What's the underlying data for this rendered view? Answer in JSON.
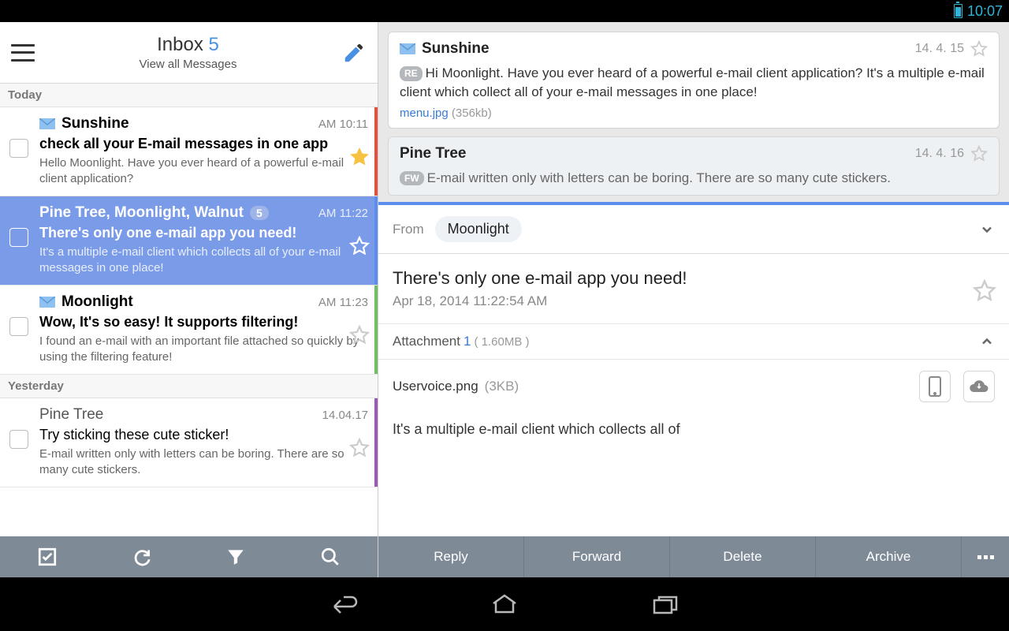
{
  "statusbar": {
    "time": "10:07"
  },
  "header": {
    "title": "Inbox",
    "count": "5",
    "subtitle": "View all Messages"
  },
  "sections": {
    "today": "Today",
    "yesterday": "Yesterday"
  },
  "messages": {
    "m0": {
      "sender": "Sunshine",
      "time": "AM 10:11",
      "subject": "check all your E-mail messages in one app",
      "preview": "Hello Moonlight. Have you ever heard of a powerful e-mail client application?"
    },
    "m1": {
      "sender": "Pine Tree, Moonlight, Walnut",
      "badge": "5",
      "time": "AM 11:22",
      "subject": "There's only one e-mail app you need!",
      "preview": "It's a multiple e-mail client which collects all of your e-mail messages in one place!"
    },
    "m2": {
      "sender": "Moonlight",
      "time": "AM 11:23",
      "subject": "Wow, It's so easy! It supports filtering!",
      "preview": "I found an e-mail with an important file attached so quickly by using the filtering feature!"
    },
    "m3": {
      "sender": "Pine Tree",
      "time": "14.04.17",
      "subject": "Try sticking these cute sticker!",
      "preview": "E-mail written only with letters can be boring. There are so many cute stickers."
    }
  },
  "thread": {
    "t0": {
      "sender": "Sunshine",
      "date": "14. 4. 15",
      "badge": "RE",
      "body": "Hi Moonlight. Have you ever heard of a powerful e-mail client application? It's a multiple e-mail client which collect all of your e-mail messages in one place!",
      "attachment_name": "menu.jpg",
      "attachment_size": "(356kb)"
    },
    "t1": {
      "sender": "Pine Tree",
      "date": "14. 4. 16",
      "badge": "FW",
      "body": "E-mail written only with letters can be boring. There are so many cute stickers."
    }
  },
  "from": {
    "label": "From",
    "name": "Moonlight"
  },
  "detail": {
    "subject": "There's only one e-mail app you need!",
    "date": "Apr 18, 2014 11:22:54 AM",
    "attachment_label": "Attachment",
    "attachment_count": "1",
    "attachment_size": "( 1.60MB )",
    "file_name": "Uservoice.png",
    "file_size": "(3KB)",
    "body": "It's a multiple e-mail client which collects all of"
  },
  "actions": {
    "reply": "Reply",
    "forward": "Forward",
    "delete": "Delete",
    "archive": "Archive"
  }
}
